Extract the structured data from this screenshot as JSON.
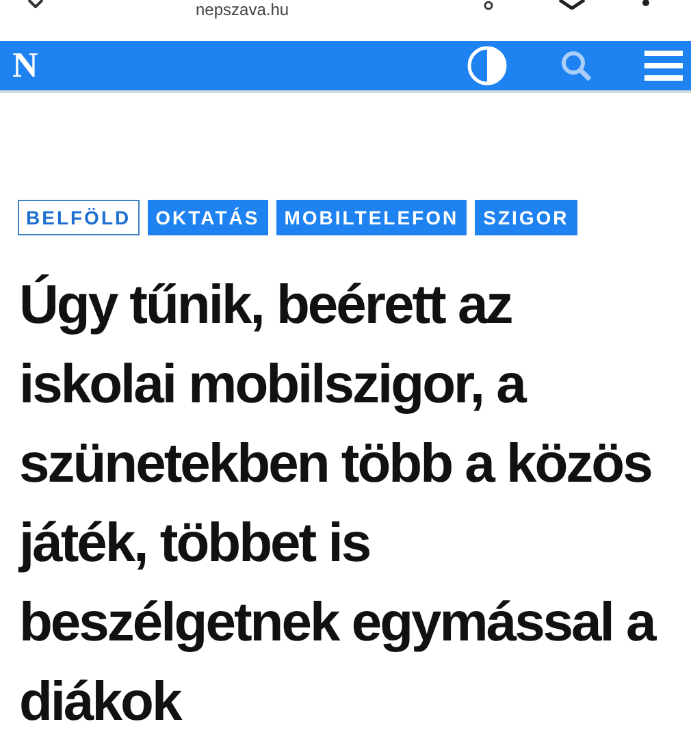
{
  "browser": {
    "url": "nepszava.hu"
  },
  "navbar": {
    "logo": "N"
  },
  "tags": [
    {
      "label": "BELFÖLD",
      "kind": "outline"
    },
    {
      "label": "OKTATÁS",
      "kind": "filled"
    },
    {
      "label": "MOBILTELEFON",
      "kind": "filled"
    },
    {
      "label": "SZIGOR",
      "kind": "filled"
    }
  ],
  "headline": "Úgy tűnik, beérett az iskolai mobilszigor, a szünetekben több a közös játék, többet is beszélgetnek egymással a diákok"
}
